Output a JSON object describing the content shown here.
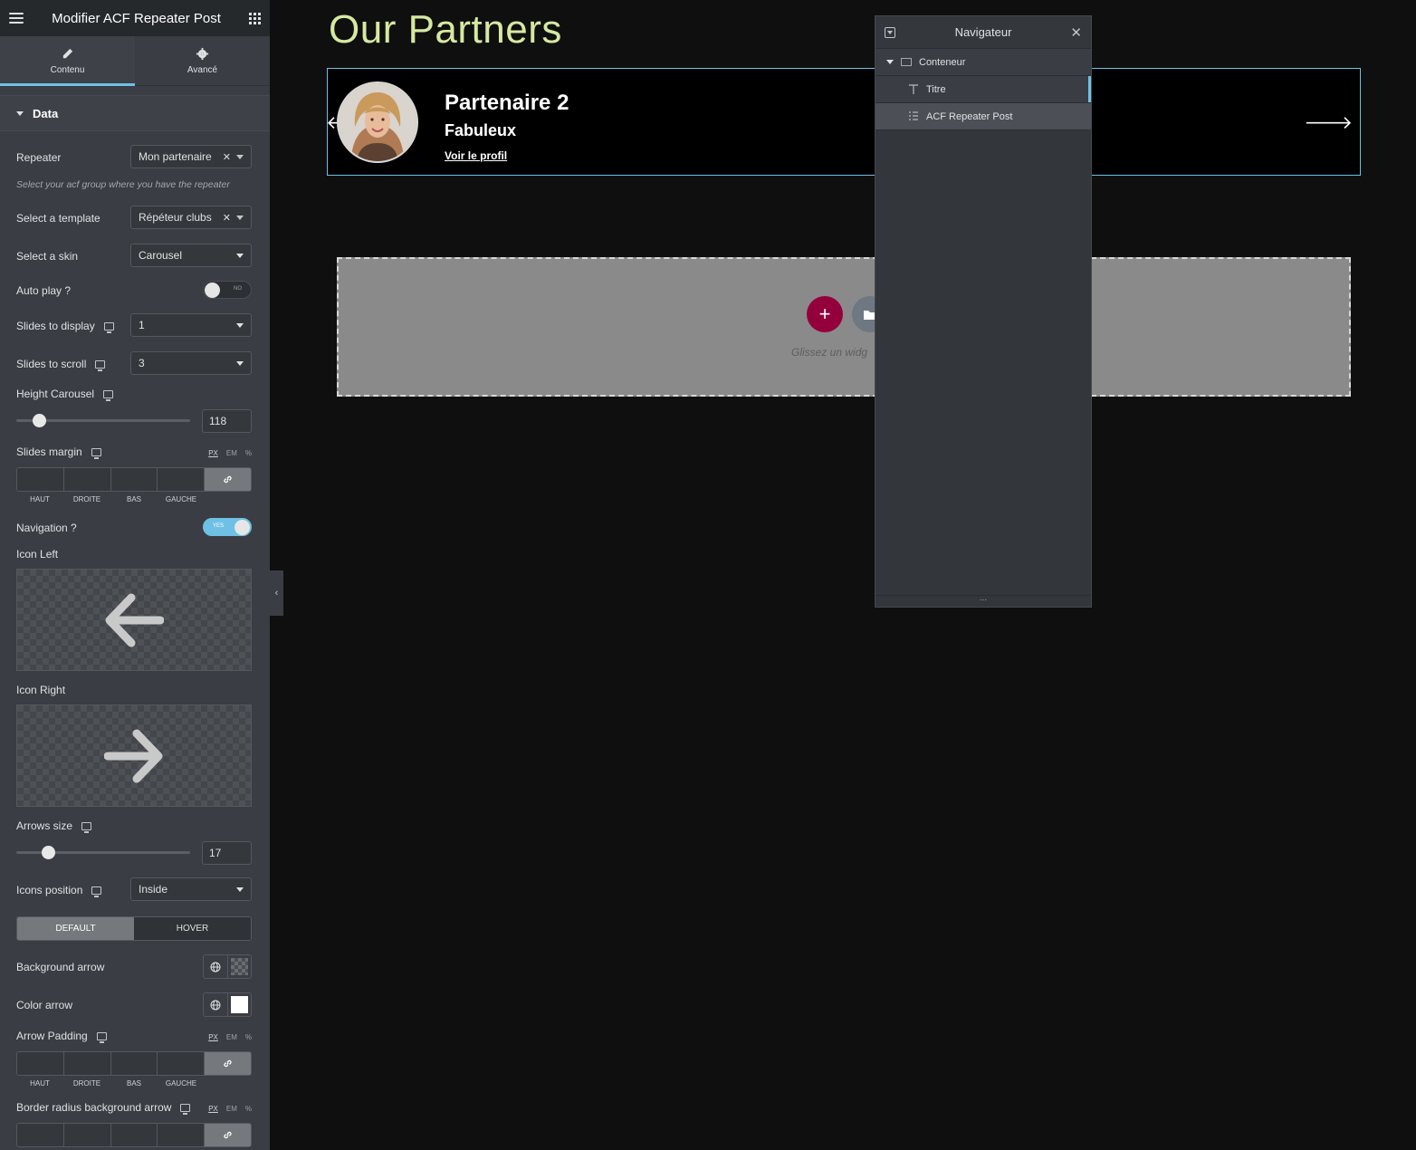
{
  "panel": {
    "title": "Modifier ACF Repeater Post",
    "tabs": [
      {
        "label": "Contenu",
        "icon": "pencil-icon",
        "active": true
      },
      {
        "label": "Avancé",
        "icon": "gear-icon",
        "active": false
      }
    ],
    "section_title": "Data",
    "controls": {
      "repeater": {
        "label": "Repeater",
        "value": "Mon partenaire",
        "note": "Select your acf group where you have the repeater"
      },
      "template": {
        "label": "Select a template",
        "value": "Répéteur clubs"
      },
      "skin": {
        "label": "Select a skin",
        "value": "Carousel"
      },
      "autoplay": {
        "label": "Auto play ?",
        "state": "NO"
      },
      "slides_display": {
        "label": "Slides to display",
        "value": "1"
      },
      "slides_scroll": {
        "label": "Slides to scroll",
        "value": "3"
      },
      "height": {
        "label": "Height Carousel",
        "value": "118",
        "slider_fraction": 0.1
      },
      "slides_margin": {
        "label": "Slides margin"
      },
      "navigation": {
        "label": "Navigation ?",
        "state": "YES"
      },
      "icon_left": {
        "label": "Icon Left"
      },
      "icon_right": {
        "label": "Icon Right"
      },
      "arrows_size": {
        "label": "Arrows size",
        "value": "17",
        "slider_fraction": 0.16
      },
      "icons_position": {
        "label": "Icons position",
        "value": "Inside"
      },
      "state_tabs": {
        "default": "DEFAULT",
        "hover": "HOVER"
      },
      "bg_arrow": {
        "label": "Background arrow"
      },
      "color_arrow": {
        "label": "Color arrow",
        "color": "#ffffff"
      },
      "arrow_padding": {
        "label": "Arrow Padding"
      },
      "border_radius": {
        "label": "Border radius background arrow"
      }
    },
    "units": {
      "px": "PX",
      "em": "EM",
      "pct": "%"
    },
    "dims": {
      "top": "HAUT",
      "right": "DROITE",
      "bottom": "BAS",
      "left": "GAUCHE"
    }
  },
  "canvas": {
    "heading": "Our Partners",
    "card": {
      "name": "Partenaire 2",
      "description": "Fabuleux",
      "link": "Voir le profil"
    },
    "drop_text": "Glissez un widg"
  },
  "navigator": {
    "title": "Navigateur",
    "items": [
      {
        "label": "Conteneur",
        "icon": "container-icon"
      },
      {
        "label": "Titre",
        "icon": "heading-icon"
      },
      {
        "label": "ACF Repeater Post",
        "icon": "list-icon"
      }
    ],
    "footer": "..."
  },
  "colors": {
    "accent": "#6ec1e4",
    "heading": "#d6e99f",
    "add_button": "#93003c"
  }
}
